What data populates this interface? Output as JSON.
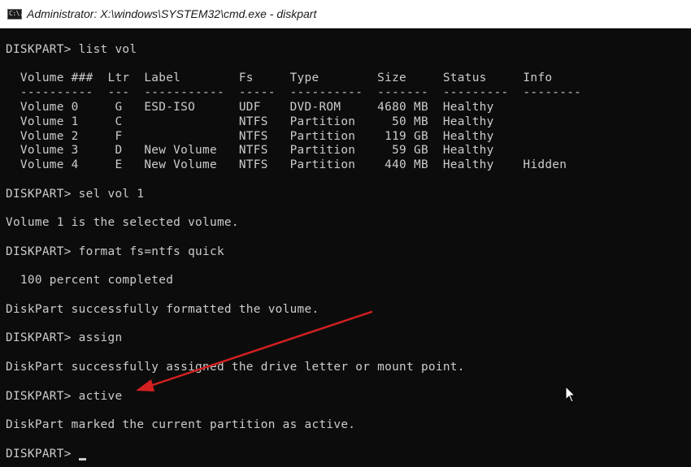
{
  "window": {
    "title": "Administrator: X:\\windows\\SYSTEM32\\cmd.exe - diskpart",
    "icon": "cmd-icon",
    "icon_glyph": "C:\\."
  },
  "console": {
    "lines": [
      "DISKPART> list vol",
      "",
      "  Volume ###  Ltr  Label        Fs     Type        Size     Status     Info",
      "  ----------  ---  -----------  -----  ----------  -------  ---------  --------",
      "  Volume 0     G   ESD-ISO      UDF    DVD-ROM     4680 MB  Healthy",
      "  Volume 1     C                NTFS   Partition     50 MB  Healthy",
      "  Volume 2     F                NTFS   Partition    119 GB  Healthy",
      "  Volume 3     D   New Volume   NTFS   Partition     59 GB  Healthy",
      "  Volume 4     E   New Volume   NTFS   Partition    440 MB  Healthy    Hidden",
      "",
      "DISKPART> sel vol 1",
      "",
      "Volume 1 is the selected volume.",
      "",
      "DISKPART> format fs=ntfs quick",
      "",
      "  100 percent completed",
      "",
      "DiskPart successfully formatted the volume.",
      "",
      "DISKPART> assign",
      "",
      "DiskPart successfully assigned the drive letter or mount point.",
      "",
      "DISKPART> active",
      "",
      "DiskPart marked the current partition as active.",
      "",
      "DISKPART> "
    ]
  },
  "colors": {
    "console_background": "#0c0c0c",
    "console_text": "#cccccc",
    "annotation_arrow": "#d42020",
    "titlebar": "#ffffff"
  },
  "icons": {
    "arrow": "red-annotation-arrow-icon",
    "pointer": "mouse-pointer-icon"
  }
}
